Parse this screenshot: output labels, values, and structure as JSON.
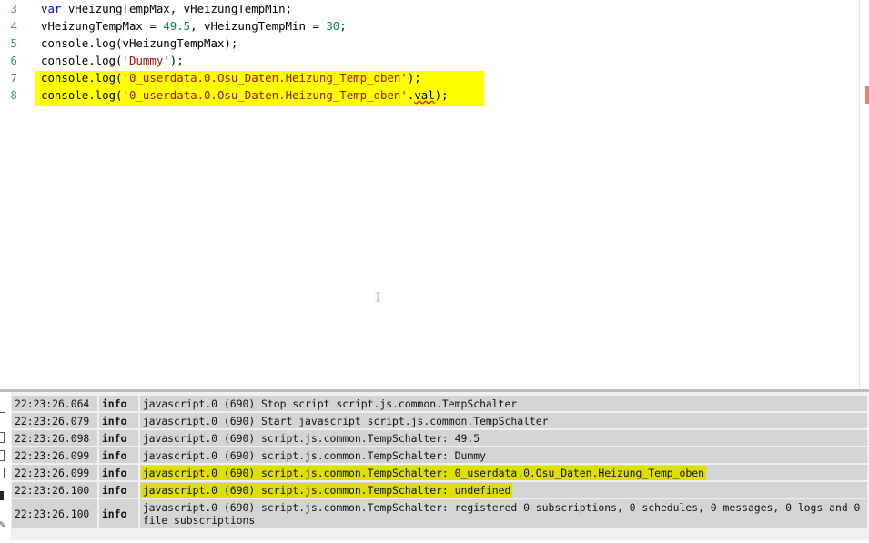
{
  "editor": {
    "lines": [
      {
        "number": "3",
        "segments": [
          {
            "text": "var",
            "cls": "kw"
          },
          {
            "text": " vHeizungTempMax, vHeizungTempMin;"
          }
        ]
      },
      {
        "number": "4",
        "segments": [
          {
            "text": "vHeizungTempMax = "
          },
          {
            "text": "49.5",
            "cls": "num"
          },
          {
            "text": ", vHeizungTempMin = "
          },
          {
            "text": "30",
            "cls": "num"
          },
          {
            "text": ";"
          }
        ]
      },
      {
        "number": "5",
        "segments": [
          {
            "text": "console.log(vHeizungTempMax);"
          }
        ]
      },
      {
        "number": "6",
        "segments": [
          {
            "text": "console.log("
          },
          {
            "text": "'Dummy'",
            "cls": "str"
          },
          {
            "text": ");"
          }
        ]
      },
      {
        "number": "7",
        "segments": [
          {
            "text": "console.log("
          },
          {
            "text": "'0_userdata.0.Osu_Daten.Heizung_Temp_oben'",
            "cls": "str"
          },
          {
            "text": ");"
          }
        ]
      },
      {
        "number": "8",
        "segments": [
          {
            "text": "console.log("
          },
          {
            "text": "'0_userdata.0.Osu_Daten.Heizung_Temp_oben'",
            "cls": "str"
          },
          {
            "text": "."
          },
          {
            "text": "val",
            "cls": "squig"
          },
          {
            "text": ");"
          }
        ]
      }
    ]
  },
  "log": {
    "entries": [
      {
        "time": "22:23:26.064",
        "severity": "info",
        "message": "javascript.0 (690) Stop script script.js.common.TempSchalter",
        "highlight": false
      },
      {
        "time": "22:23:26.079",
        "severity": "info",
        "message": "javascript.0 (690) Start javascript script.js.common.TempSchalter",
        "highlight": false
      },
      {
        "time": "22:23:26.098",
        "severity": "info",
        "message": "javascript.0 (690) script.js.common.TempSchalter: 49.5",
        "highlight": false
      },
      {
        "time": "22:23:26.099",
        "severity": "info",
        "message": "javascript.0 (690) script.js.common.TempSchalter: Dummy",
        "highlight": false
      },
      {
        "time": "22:23:26.099",
        "severity": "info",
        "message": "javascript.0 (690) script.js.common.TempSchalter: 0_userdata.0.Osu_Daten.Heizung_Temp_oben",
        "highlight": true
      },
      {
        "time": "22:23:26.100",
        "severity": "info",
        "message": "javascript.0 (690) script.js.common.TempSchalter: undefined",
        "highlight": true
      },
      {
        "time": "22:23:26.100",
        "severity": "info",
        "message": "javascript.0 (690) script.js.common.TempSchalter: registered 0 subscriptions, 0 schedules, 0 messages, 0 logs and 0 file subscriptions",
        "highlight": false
      }
    ]
  },
  "colors": {
    "code_highlight": "#ffff00",
    "log_highlight": "#dede00",
    "keyword": "#0000ff",
    "number": "#09885a",
    "string": "#a31515",
    "line_number": "#2b91af"
  }
}
